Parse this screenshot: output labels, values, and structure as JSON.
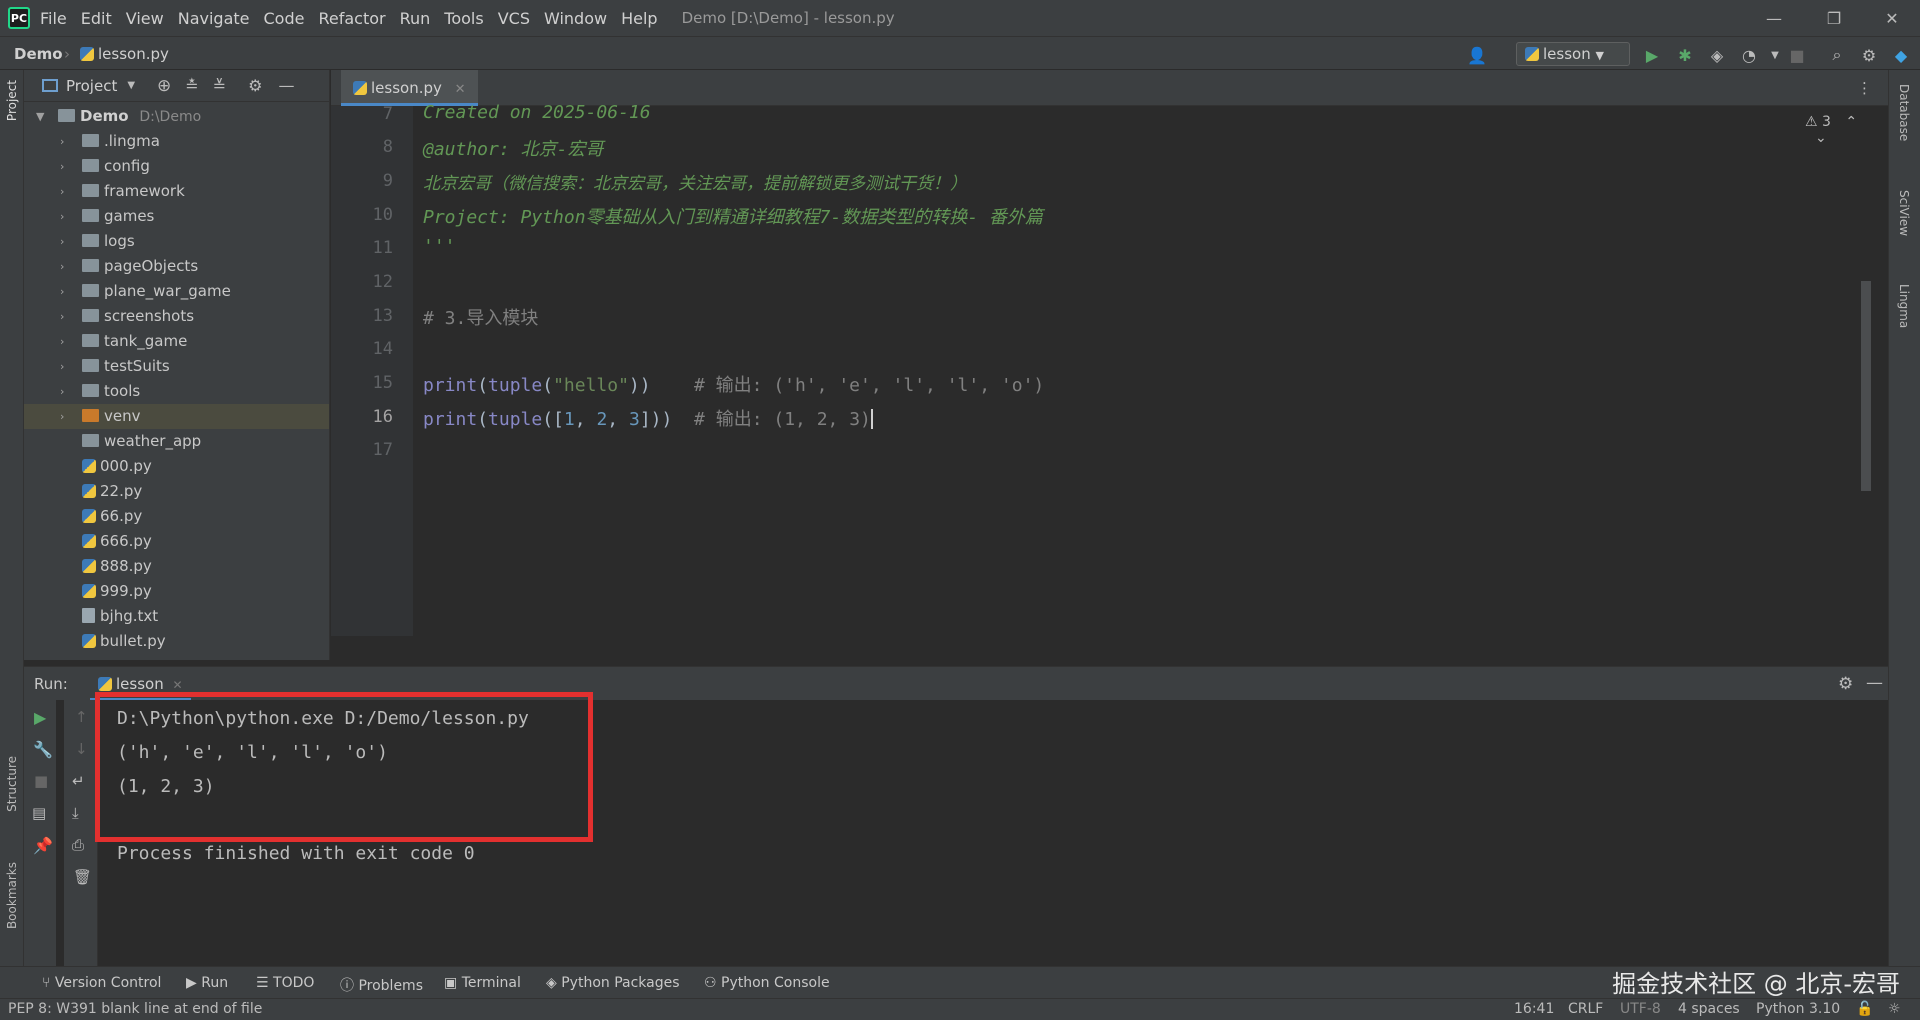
{
  "menubar": {
    "items": [
      "File",
      "Edit",
      "View",
      "Navigate",
      "Code",
      "Refactor",
      "Run",
      "Tools",
      "VCS",
      "Window",
      "Help"
    ],
    "window_title": "Demo [D:\\Demo] - lesson.py"
  },
  "navbar": {
    "project": "Demo",
    "file": "lesson.py",
    "run_config": "lesson"
  },
  "project_panel": {
    "title": "Project",
    "root_name": "Demo",
    "root_path": "D:\\Demo",
    "folders": [
      ".lingma",
      "config",
      "framework",
      "games",
      "logs",
      "pageObjects",
      "plane_war_game",
      "screenshots",
      "tank_game",
      "testSuits",
      "tools",
      "venv",
      "weather_app"
    ],
    "files": [
      "000.py",
      "22.py",
      "66.py",
      "666.py",
      "888.py",
      "999.py",
      "bjhg.txt",
      "bullet.py"
    ]
  },
  "editor": {
    "tab_label": "lesson.py",
    "inspection_count": "3",
    "line_numbers": [
      "7",
      "8",
      "9",
      "10",
      "11",
      "12",
      "13",
      "14",
      "15",
      "16",
      "17"
    ],
    "lines": {
      "l7": "Created on 2025-06-16",
      "l8": "@author: 北京-宏哥",
      "l9": "北京宏哥（微信搜索：北京宏哥，关注宏哥，提前解锁更多测试干货！）",
      "l10": "Project: Python零基础从入门到精通详细教程7-数据类型的转换- 番外篇",
      "l11": "'''",
      "l13": "# 3.导入模块",
      "l15_code_a": "print",
      "l15_code_b": "(",
      "l15_code_c": "tuple",
      "l15_code_d": "(",
      "l15_str": "\"hello\"",
      "l15_code_e": "))",
      "l15_comment": "# 输出: ('h', 'e', 'l', 'l', 'o')",
      "l16_code_a": "print",
      "l16_code_b": "(",
      "l16_code_c": "tuple",
      "l16_code_d": "([",
      "l16_n1": "1",
      "l16_sep1": ", ",
      "l16_n2": "2",
      "l16_sep2": ", ",
      "l16_n3": "3",
      "l16_code_e": "]))",
      "l16_comment": "# 输出: (1, 2, 3)"
    }
  },
  "right_stripe": [
    "Database",
    "SciView",
    "Lingma"
  ],
  "left_stripe": [
    "Project",
    "Structure",
    "Bookmarks"
  ],
  "run_panel": {
    "label": "Run:",
    "tab": "lesson",
    "console": {
      "cmd": "D:\\Python\\python.exe D:/Demo/lesson.py",
      "out1": "('h', 'e', 'l', 'l', 'o')",
      "out2": "(1, 2, 3)",
      "finish": "Process finished with exit code 0"
    }
  },
  "bottom_tools": [
    "Version Control",
    "Run",
    "TODO",
    "Problems",
    "Terminal",
    "Python Packages",
    "Python Console"
  ],
  "statusbar": {
    "message": "PEP 8: W391 blank line at end of file",
    "position": "16:41",
    "line_sep": "CRLF",
    "encoding": "UTF-8",
    "indent": "4 spaces",
    "interpreter": "Python 3.10"
  },
  "watermark": "掘金技术社区 @ 北京-宏哥",
  "colors": {
    "highlight_box": "#e3302f",
    "background": "#2b2b2b",
    "panel": "#3c3f41"
  }
}
